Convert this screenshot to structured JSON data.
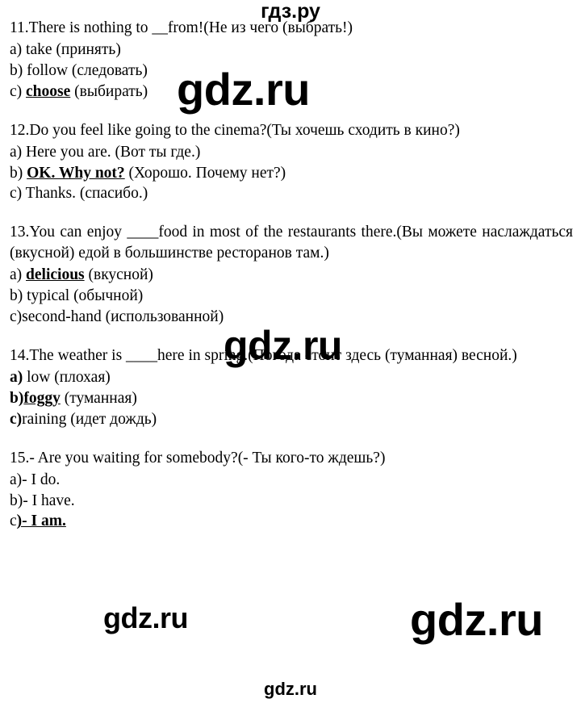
{
  "watermarks": {
    "header_cyrillic": "гдз.ру",
    "big_1": "gdz.ru",
    "big_2": "gdz.ru",
    "mid_1": "gdz.ru",
    "big_3": "gdz.ru",
    "footer": "gdz.ru"
  },
  "exercises": [
    {
      "number": "11.",
      "stem": "There is nothing to __from!(Не из чего (выбрать!)",
      "stem_english": "There is nothing to __from!",
      "stem_translation": "(Не из чего (выбрать!)",
      "justified": false,
      "options": [
        {
          "marker": "a)",
          "marker_bold": false,
          "text": " take (принять)",
          "answer": false
        },
        {
          "marker": "b)",
          "marker_bold": false,
          "text": " follow (следовать)",
          "answer": false
        },
        {
          "marker": "c)",
          "marker_bold": false,
          "pre": " ",
          "answer_text": "choose",
          "post": " (выбирать)",
          "answer": true
        }
      ]
    },
    {
      "number": "12.",
      "stem": "Do you feel like going to the cinema?(Ты хочешь сходить в кино?)",
      "stem_english": "Do you feel like going to the cinema?",
      "stem_translation": "(Ты хочешь сходить в кино?)",
      "justified": true,
      "options": [
        {
          "marker": "a)",
          "marker_bold": false,
          "text": " Here you are. (Вот ты где.)",
          "answer": false
        },
        {
          "marker": "b)",
          "marker_bold": false,
          "pre": " ",
          "answer_text": "OK. Why not?",
          "post": " (Хорошо. Почему нет?)",
          "answer": true
        },
        {
          "marker": "c)",
          "marker_bold": false,
          "text": " Thanks. (спасибо.)",
          "answer": false
        }
      ]
    },
    {
      "number": "13.",
      "stem": "You can enjoy ____food in most of the restaurants there.(Вы можете наслаждаться (вкусной) едой в большинстве ресторанов там.)",
      "stem_english": "You can enjoy ____food in most of the restaurants there.",
      "stem_translation": "(Вы можете наслаждаться (вкусной) едой в большинстве ресторанов там.)",
      "justified": true,
      "options": [
        {
          "marker": "a)",
          "marker_bold": false,
          "pre": " ",
          "answer_text": "delicious",
          "post": " (вкусной)",
          "answer": true
        },
        {
          "marker": "b)",
          "marker_bold": false,
          "text": " typical (обычной)",
          "answer": false
        },
        {
          "marker": "c)",
          "marker_bold": false,
          "text": "second-hand (использованной)",
          "answer": false
        }
      ]
    },
    {
      "number": "14.",
      "stem": "The weather is ____here in spring.(Погода стоит здесь (туманная) весной.)",
      "stem_english": "The weather is ____here in spring.",
      "stem_translation": "(Погода стоит здесь (туманная) весной.)",
      "justified": true,
      "options": [
        {
          "marker": "a)",
          "marker_bold": true,
          "text": " low (плохая)",
          "answer": false
        },
        {
          "marker": "b)",
          "marker_bold": true,
          "pre": "",
          "answer_text": "foggy",
          "post": " (туманная)",
          "answer": true
        },
        {
          "marker": "c)",
          "marker_bold": true,
          "text": "raining (идет дождь)",
          "answer": false
        }
      ]
    },
    {
      "number": "15.",
      "stem": "- Are you waiting for somebody?(- Ты кого-то ждешь?)",
      "stem_english": "- Are you waiting for somebody?",
      "stem_translation": "(- Ты кого-то ждешь?)",
      "justified": false,
      "options": [
        {
          "marker": "a)",
          "marker_bold": false,
          "text": "- I do.",
          "answer": false
        },
        {
          "marker": "b)",
          "marker_bold": false,
          "text": "- I have.",
          "answer": false
        },
        {
          "marker": "c",
          "marker_bold": false,
          "pre": "",
          "answer_text": ")- I am.",
          "post": "",
          "answer": true
        }
      ]
    }
  ]
}
